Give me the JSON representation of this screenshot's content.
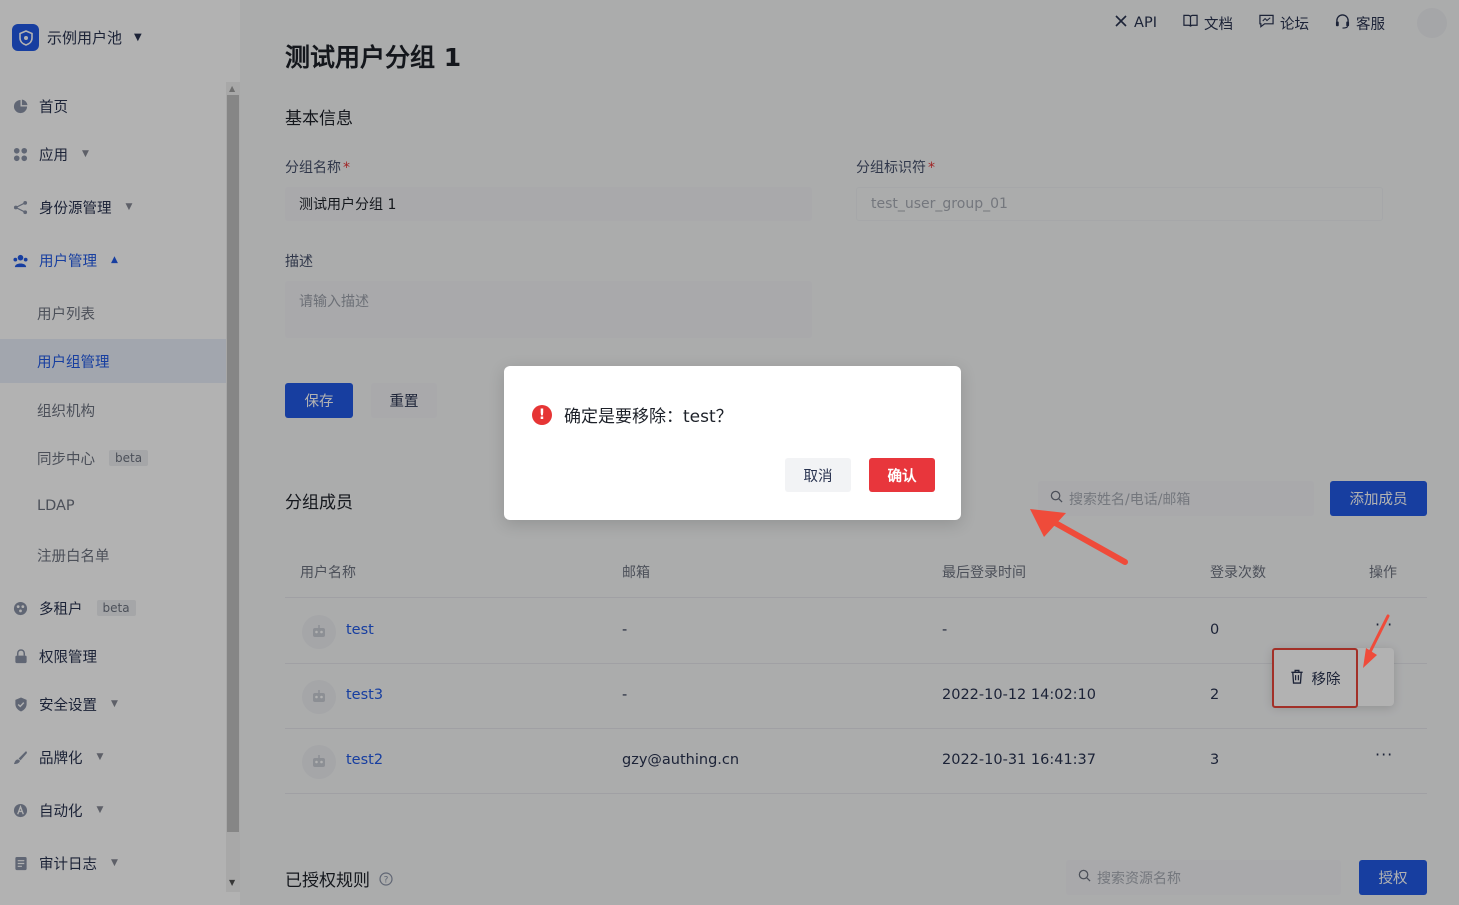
{
  "pool": {
    "name": "示例用户池"
  },
  "sidebar": {
    "items": [
      {
        "label": "首页"
      },
      {
        "label": "应用"
      },
      {
        "label": "身份源管理"
      },
      {
        "label": "用户管理"
      },
      {
        "label": "用户列表"
      },
      {
        "label": "用户组管理"
      },
      {
        "label": "组织机构"
      },
      {
        "label": "同步中心",
        "badge": "beta"
      },
      {
        "label": "LDAP"
      },
      {
        "label": "注册白名单"
      },
      {
        "label": "多租户",
        "badge": "beta"
      },
      {
        "label": "权限管理"
      },
      {
        "label": "安全设置"
      },
      {
        "label": "品牌化"
      },
      {
        "label": "自动化"
      },
      {
        "label": "审计日志"
      }
    ]
  },
  "topbar": {
    "api": "API",
    "docs": "文档",
    "forum": "论坛",
    "support": "客服"
  },
  "page": {
    "title": "测试用户分组 1"
  },
  "basic": {
    "title": "基本信息",
    "name_label": "分组名称",
    "name_value": "测试用户分组 1",
    "code_label": "分组标识符",
    "code_value": "test_user_group_01",
    "desc_label": "描述",
    "desc_placeholder": "请输入描述",
    "save": "保存",
    "reset": "重置"
  },
  "members": {
    "title": "分组成员",
    "search_placeholder": "搜索姓名/电话/邮箱",
    "add": "添加成员",
    "columns": [
      "用户名称",
      "邮箱",
      "最后登录时间",
      "登录次数",
      "操作"
    ],
    "rows": [
      {
        "name": "test",
        "email": "-",
        "last_login": "-",
        "count": "0"
      },
      {
        "name": "test3",
        "email": "-",
        "last_login": "2022-10-12 14:02:10",
        "count": "2"
      },
      {
        "name": "test2",
        "email": "gzy@authing.cn",
        "last_login": "2022-10-31 16:41:37",
        "count": "3"
      }
    ],
    "menu_remove": "移除"
  },
  "rules": {
    "title": "已授权规则",
    "search_placeholder": "搜索资源名称",
    "grant": "授权"
  },
  "modal": {
    "message": "确定是要移除：test？",
    "cancel": "取消",
    "confirm": "确认"
  },
  "colors": {
    "primary": "#215ae5",
    "danger": "#e8363c"
  }
}
